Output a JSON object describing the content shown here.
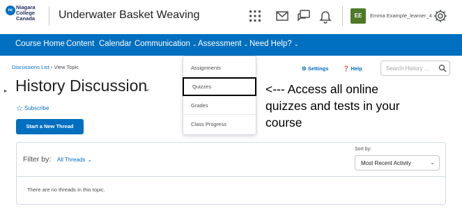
{
  "header": {
    "logo_text": "Niagara\nCollege\nCanada",
    "course_title": "Underwater Basket Weaving",
    "user": {
      "initials": "EE",
      "name": "Emma Example_learner_4"
    },
    "icons": [
      "waffle-icon",
      "mail-icon",
      "chat-icon",
      "bell-icon",
      "gear-icon"
    ]
  },
  "nav": {
    "items": [
      {
        "label": "Course Home"
      },
      {
        "label": "Content"
      },
      {
        "label": "Calendar"
      },
      {
        "label": "Communication",
        "chevron": "⌄"
      },
      {
        "label": "Assessment",
        "chevron": "⌄"
      },
      {
        "label": "Need Help?",
        "chevron": "⌄"
      }
    ]
  },
  "dropdown": {
    "items": [
      "Assignments",
      "Quizzes",
      "Grades",
      "Class Progress"
    ],
    "highlighted": "Quizzes"
  },
  "page": {
    "breadcrumb": {
      "link": "Discussions List",
      "sep": "›",
      "current": "View Topic"
    },
    "title": "History Discussion",
    "subscribe_label": "Subscribe",
    "start_thread_label": "Start a New Thread",
    "settings_label": "Settings",
    "help_label": "Help",
    "search_placeholder": "Search History ...",
    "filter_label": "Filter by:",
    "filter_value": "All Threads",
    "sort_label": "Sort by:",
    "sort_value": "Most Recent Activity",
    "empty_message": "There are no threads in this topic."
  },
  "annotation": "<--- Access all online\nquizzes and tests in your\ncourse",
  "colors": {
    "brand_blue": "#006fbf",
    "avatar_green": "#4e7a27"
  }
}
